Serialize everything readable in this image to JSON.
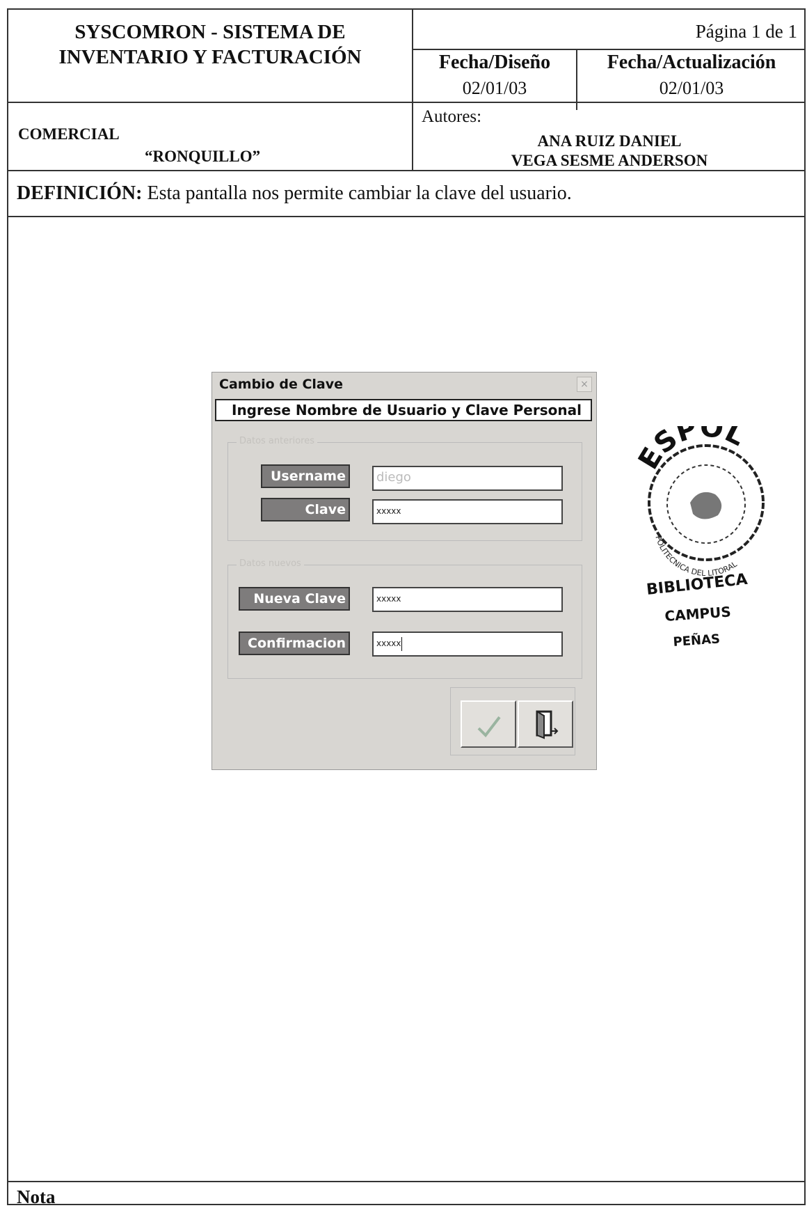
{
  "header": {
    "title_line1": "SYSCOMRON - SISTEMA DE",
    "title_line2": "INVENTARIO Y FACTURACIÓN",
    "pagina": "Página 1 de 1",
    "fecha_diseno_label": "Fecha/Diseño",
    "fecha_diseno_value": "02/01/03",
    "fecha_actualizacion_label": "Fecha/Actualización",
    "fecha_actualizacion_value": "02/01/03",
    "comercial_line1": "COMERCIAL",
    "comercial_line2": "“RONQUILLO”",
    "autores_label": "Autores:",
    "author1": "ANA RUIZ DANIEL",
    "author2": "VEGA SESME ANDERSON"
  },
  "definicion": {
    "label": "DEFINICIÓN:",
    "text": " Esta pantalla nos permite cambiar la clave del usuario."
  },
  "dialog": {
    "title": "Cambio de Clave",
    "close_glyph": "×",
    "subtitle": "Ingrese Nombre de Usuario y Clave Personal",
    "group1_caption": "Datos anteriores",
    "group2_caption": "Datos nuevos",
    "username_label": "Username",
    "username_value": "diego",
    "clave_label": "Clave",
    "clave_value": "xxxxx",
    "nueva_clave_label": "Nueva Clave",
    "nueva_clave_value": "xxxxx",
    "confirmacion_label": "Confirmacion",
    "confirmacion_value": "xxxxx",
    "accept_icon": "checkmark-icon",
    "exit_icon": "exit-door-icon"
  },
  "stamp": {
    "top_text": "ESPOL",
    "arc_text": "POLITECNICA DEL LITORAL",
    "line1": "BIBLIOTECA",
    "line2": "CAMPUS",
    "line3": "PEÑAS"
  },
  "nota": "Nota"
}
